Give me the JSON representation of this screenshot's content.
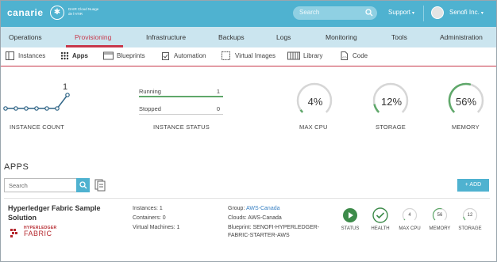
{
  "brand": {
    "logo_text": "canarie",
    "sub_lines": "DAIR Cloud Nuage de l'ATIR"
  },
  "header": {
    "search_placeholder": "Search",
    "support_label": "Support",
    "user_label": "Senofi Inc."
  },
  "main_nav": [
    {
      "label": "Operations"
    },
    {
      "label": "Provisioning",
      "active": true
    },
    {
      "label": "Infrastructure"
    },
    {
      "label": "Backups"
    },
    {
      "label": "Logs"
    },
    {
      "label": "Monitoring"
    },
    {
      "label": "Tools"
    },
    {
      "label": "Administration"
    }
  ],
  "sub_nav": [
    {
      "label": "Instances",
      "icon": "instances-icon"
    },
    {
      "label": "Apps",
      "icon": "apps-grid-icon",
      "active": true
    },
    {
      "label": "Blueprints",
      "icon": "blueprints-icon"
    },
    {
      "label": "Automation",
      "icon": "automation-icon"
    },
    {
      "label": "Virtual Images",
      "icon": "virtual-images-icon"
    },
    {
      "label": "Library",
      "icon": "library-icon"
    },
    {
      "label": "Code",
      "icon": "code-icon"
    }
  ],
  "stats": {
    "instance_count_label": "INSTANCE COUNT",
    "instance_count_value": "1",
    "instance_status_label": "INSTANCE STATUS",
    "running_label": "Running",
    "running_value": "1",
    "stopped_label": "Stopped",
    "stopped_value": "0",
    "cpu": {
      "value": "4%",
      "label": "MAX CPU",
      "fraction": 0.04
    },
    "storage": {
      "value": "12%",
      "label": "STORAGE",
      "fraction": 0.12
    },
    "memory": {
      "value": "56%",
      "label": "MEMORY",
      "fraction": 0.56
    },
    "gauge_color": "#5fa86a",
    "track_color": "#d6d6d6"
  },
  "apps": {
    "title": "APPS",
    "search_placeholder": "Search",
    "add_label": "+ ADD",
    "items": [
      {
        "name": "Hyperledger Fabric Sample Solution",
        "logo_top": "HYPERLEDGER",
        "logo_bottom": "FABRIC",
        "instances": "Instances: 1",
        "containers": "Containers: 0",
        "vms": "Virtual Machines: 1",
        "group_prefix": "Group: ",
        "group_value": "AWS-Canada",
        "clouds": "Clouds: AWS-Canada",
        "blueprint_line1": "Blueprint: SENOFI-HYPERLEDGER-",
        "blueprint_line2": "FABRIC-STARTER-AWS",
        "status_label": "STATUS",
        "health_label": "HEALTH",
        "cpu_value": "4",
        "cpu_label": "MAX CPU",
        "memory_value": "56",
        "memory_label": "MEMORY",
        "storage_value": "12",
        "storage_label": "STORAGE"
      }
    ]
  }
}
